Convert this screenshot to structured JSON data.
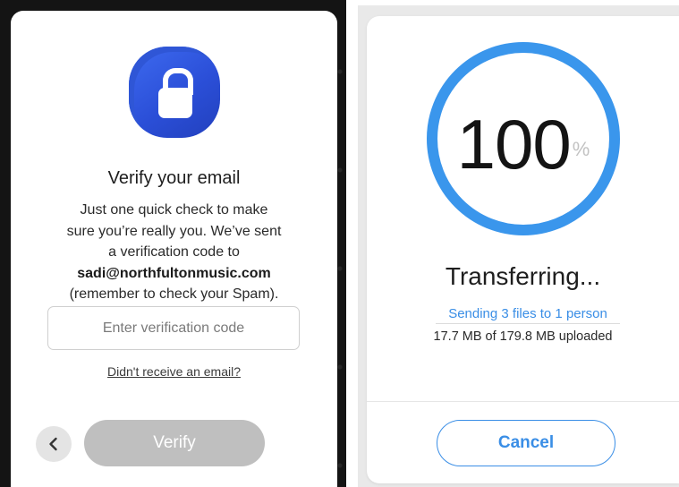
{
  "verify": {
    "title": "Verify your email",
    "desc_line1": "Just one quick check to make",
    "desc_line2": "sure you’re really you. We’ve sent",
    "desc_line3": "a verification code to",
    "email": "sadi@northfultonmusic.com",
    "desc_line5": "(remember to check your Spam).",
    "input_placeholder": "Enter verification code",
    "input_value": "",
    "resend_link": "Didn't receive an email?",
    "verify_button": "Verify",
    "icons": {
      "badge": "lock-icon",
      "back": "chevron-left-icon"
    },
    "colors": {
      "badge": "#2b4fd8",
      "button_disabled": "#bfbfbf"
    }
  },
  "transfer": {
    "progress_value": "100",
    "progress_unit": "%",
    "progress_fraction": 1.0,
    "title": "Transferring...",
    "sending_link": "Sending 3 files to 1 person",
    "uploaded": "17.7 MB of 179.8 MB uploaded",
    "cancel_button": "Cancel",
    "colors": {
      "ring": "#3a96ec",
      "accent": "#3a8ee6"
    }
  }
}
